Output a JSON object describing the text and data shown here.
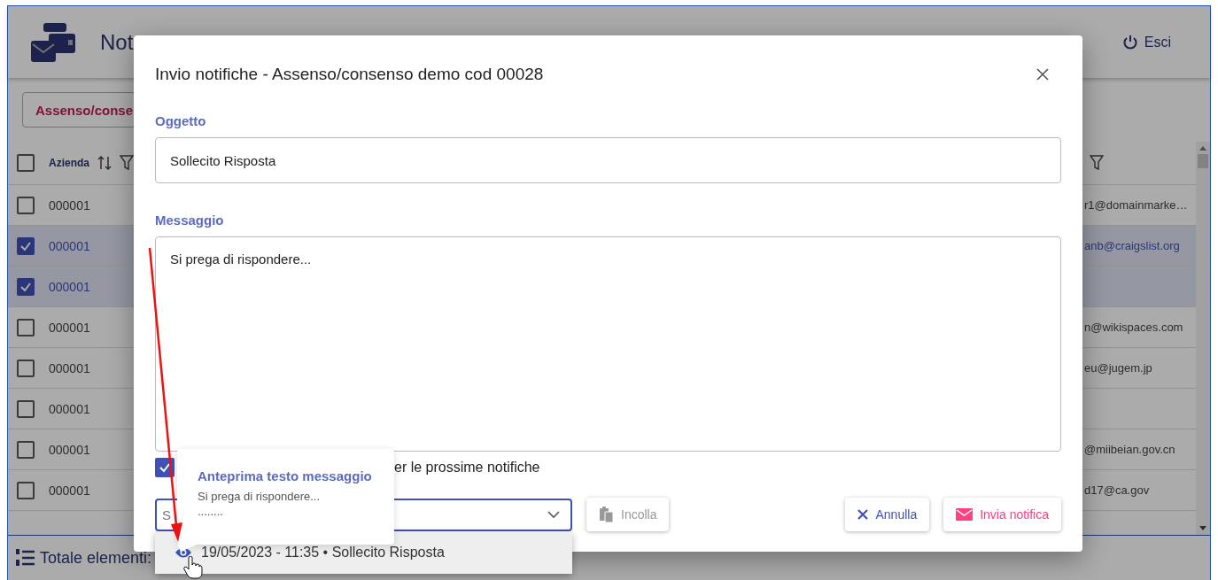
{
  "header": {
    "title": "Not",
    "logout": "Esci"
  },
  "tab": {
    "label": "Assenso/conse"
  },
  "table": {
    "columns": [
      {
        "label": "Azienda"
      }
    ],
    "all_checked": false,
    "rows": [
      {
        "column_1": "000001",
        "column_2": "r1@domainmarke…",
        "selected": false
      },
      {
        "column_1": "000001",
        "column_2": "anb@craigslist.org",
        "selected": true
      },
      {
        "column_1": "000001",
        "column_2": "",
        "selected": true
      },
      {
        "column_1": "000001",
        "column_2": "n@wikispaces.com",
        "selected": false
      },
      {
        "column_1": "000001",
        "column_2": "eu@jugem.jp",
        "selected": false
      },
      {
        "column_1": "000001",
        "column_2": "",
        "selected": false
      },
      {
        "column_1": "000001",
        "column_2": "@miibeian.gov.cn",
        "selected": false
      },
      {
        "column_1": "000001",
        "column_2": "d17@ca.gov",
        "selected": false
      }
    ]
  },
  "footer": {
    "label": "Totale elementi:"
  },
  "dialog": {
    "title": "Invio notifiche - Assenso/consenso demo cod 00028",
    "subject": {
      "label": "Oggetto",
      "value": "Sollecito Risposta"
    },
    "message": {
      "label": "Messaggio",
      "value": "Si prega di rispondere..."
    },
    "remember": {
      "label": "er le prossime notifiche",
      "checked": true
    },
    "template_select": {
      "placeholder": "S",
      "expanded": true,
      "options": [
        {
          "label": "19/05/2023 - 11:35 • Sollecito Risposta",
          "highlighted": true
        }
      ]
    },
    "buttons": [
      {
        "label": "Incolla",
        "kind": "paste",
        "disabled": true
      },
      {
        "label": "Annulla",
        "kind": "cancel",
        "disabled": false
      },
      {
        "label": "Invia notifica",
        "kind": "send",
        "disabled": false
      }
    ]
  },
  "tooltip": {
    "title": "Anteprima testo messaggio",
    "lines": [
      "Si prega di rispondere...",
      "........"
    ]
  }
}
